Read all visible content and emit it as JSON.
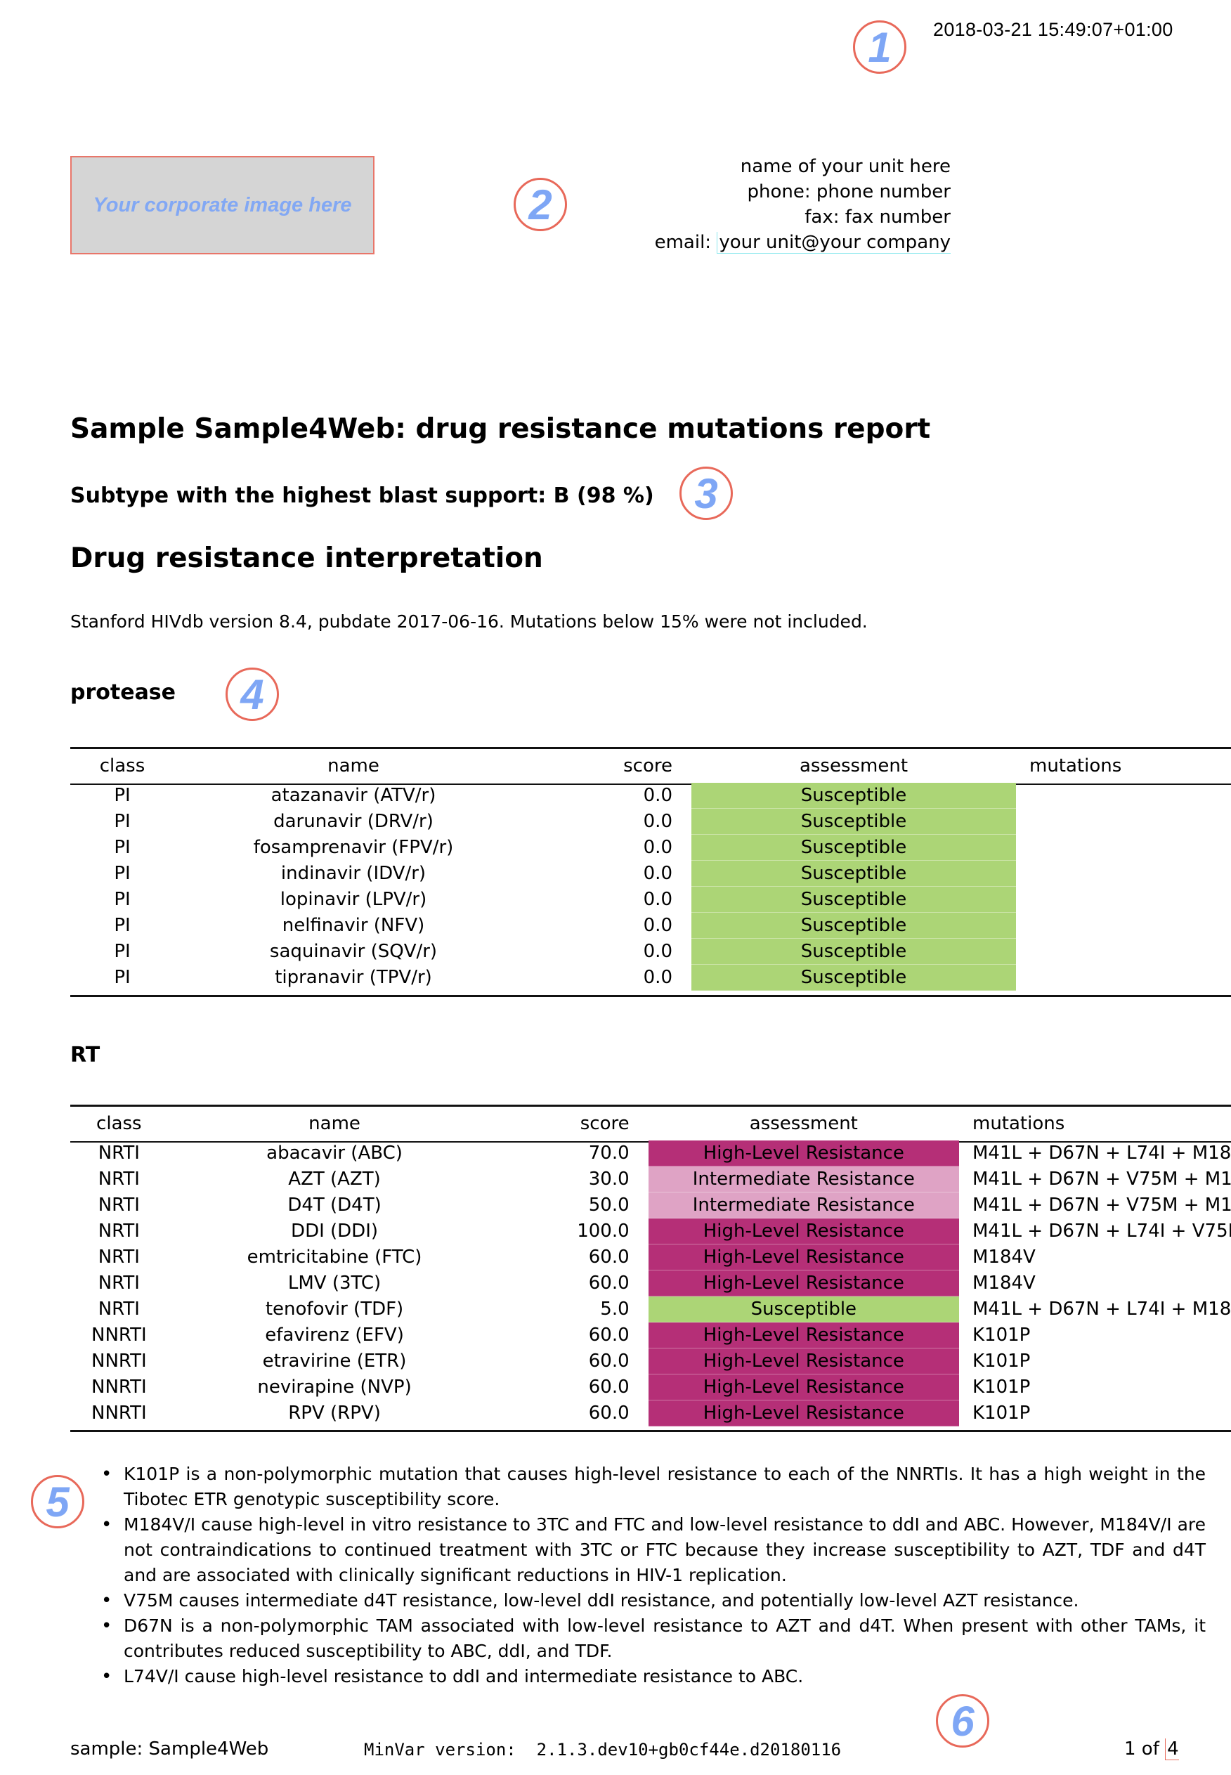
{
  "header": {
    "timestamp": "2018-03-21 15:49:07+01:00",
    "logo_placeholder": "Your corporate image here",
    "contact": {
      "unit_name": "name of your unit here",
      "phone_label": "phone:",
      "phone_value": "phone number",
      "fax_label": "fax:",
      "fax_value": "fax number",
      "email_label": "email:",
      "email_value": "your unit@your company"
    }
  },
  "callouts": [
    "1",
    "2",
    "3",
    "4",
    "5",
    "6"
  ],
  "report": {
    "title": "Sample Sample4Web: drug resistance mutations report",
    "subtype": "Subtype with the highest blast support: B (98 %)",
    "section_title": "Drug resistance interpretation",
    "db_note": "Stanford HIVdb version 8.4, pubdate 2017-06-16. Mutations below 15% were not included."
  },
  "table_headers": {
    "class": "class",
    "name": "name",
    "score": "score",
    "assessment": "assessment",
    "mutations": "mutations"
  },
  "assessment_colors": {
    "Susceptible": "#acd576",
    "Intermediate Resistance": "#dfa3c5",
    "High-Level Resistance": "#b52f77"
  },
  "protease": {
    "title": "protease",
    "rows": [
      {
        "class": "PI",
        "name": "atazanavir (ATV/r)",
        "score": "0.0",
        "assessment": "Susceptible",
        "mutations": ""
      },
      {
        "class": "PI",
        "name": "darunavir (DRV/r)",
        "score": "0.0",
        "assessment": "Susceptible",
        "mutations": ""
      },
      {
        "class": "PI",
        "name": "fosamprenavir (FPV/r)",
        "score": "0.0",
        "assessment": "Susceptible",
        "mutations": ""
      },
      {
        "class": "PI",
        "name": "indinavir (IDV/r)",
        "score": "0.0",
        "assessment": "Susceptible",
        "mutations": ""
      },
      {
        "class": "PI",
        "name": "lopinavir (LPV/r)",
        "score": "0.0",
        "assessment": "Susceptible",
        "mutations": ""
      },
      {
        "class": "PI",
        "name": "nelfinavir (NFV)",
        "score": "0.0",
        "assessment": "Susceptible",
        "mutations": ""
      },
      {
        "class": "PI",
        "name": "saquinavir (SQV/r)",
        "score": "0.0",
        "assessment": "Susceptible",
        "mutations": ""
      },
      {
        "class": "PI",
        "name": "tipranavir (TPV/r)",
        "score": "0.0",
        "assessment": "Susceptible",
        "mutations": ""
      }
    ]
  },
  "rt": {
    "title": "RT",
    "rows": [
      {
        "class": "NRTI",
        "name": "abacavir (ABC)",
        "score": "70.0",
        "assessment": "High-Level Resistance",
        "mutations": "M41L + D67N + L74I + M18"
      },
      {
        "class": "NRTI",
        "name": "AZT (AZT)",
        "score": "30.0",
        "assessment": "Intermediate Resistance",
        "mutations": "M41L + D67N + V75M + M1"
      },
      {
        "class": "NRTI",
        "name": "D4T (D4T)",
        "score": "50.0",
        "assessment": "Intermediate Resistance",
        "mutations": "M41L + D67N + V75M + M1"
      },
      {
        "class": "NRTI",
        "name": "DDI (DDI)",
        "score": "100.0",
        "assessment": "High-Level Resistance",
        "mutations": "M41L + D67N + L74I + V75M"
      },
      {
        "class": "NRTI",
        "name": "emtricitabine (FTC)",
        "score": "60.0",
        "assessment": "High-Level Resistance",
        "mutations": "M184V"
      },
      {
        "class": "NRTI",
        "name": "LMV (3TC)",
        "score": "60.0",
        "assessment": "High-Level Resistance",
        "mutations": "M184V"
      },
      {
        "class": "NRTI",
        "name": "tenofovir (TDF)",
        "score": "5.0",
        "assessment": "Susceptible",
        "mutations": "M41L + D67N + L74I + M18"
      },
      {
        "class": "NNRTI",
        "name": "efavirenz (EFV)",
        "score": "60.0",
        "assessment": "High-Level Resistance",
        "mutations": "K101P"
      },
      {
        "class": "NNRTI",
        "name": "etravirine (ETR)",
        "score": "60.0",
        "assessment": "High-Level Resistance",
        "mutations": "K101P"
      },
      {
        "class": "NNRTI",
        "name": "nevirapine (NVP)",
        "score": "60.0",
        "assessment": "High-Level Resistance",
        "mutations": "K101P"
      },
      {
        "class": "NNRTI",
        "name": "RPV (RPV)",
        "score": "60.0",
        "assessment": "High-Level Resistance",
        "mutations": "K101P"
      }
    ]
  },
  "comments": [
    "K101P is a non-polymorphic mutation that causes high-level resistance to each of the NNRTIs. It has a high weight in the Tibotec ETR genotypic susceptibility score.",
    "M184V/I cause high-level in vitro resistance to 3TC and FTC and low-level resistance to ddI and ABC. However, M184V/I are not contraindications to continued treatment with 3TC or FTC because they increase susceptibility to AZT, TDF and d4T and are associated with clinically significant reductions in HIV-1 replication.",
    "V75M causes intermediate d4T resistance, low-level ddI resistance, and potentially low-level AZT resistance.",
    "D67N is a non-polymorphic TAM associated with low-level resistance to AZT and d4T. When present with other TAMs, it contributes reduced susceptibility to ABC, ddI, and TDF.",
    "L74V/I cause high-level resistance to ddI and intermediate resistance to ABC."
  ],
  "footer": {
    "sample": "sample: Sample4Web",
    "version_label": "MinVar version:",
    "version_value": "2.1.3.dev10+gb0cf44e.d20180116",
    "page_current": "1 of",
    "page_total": "4"
  }
}
